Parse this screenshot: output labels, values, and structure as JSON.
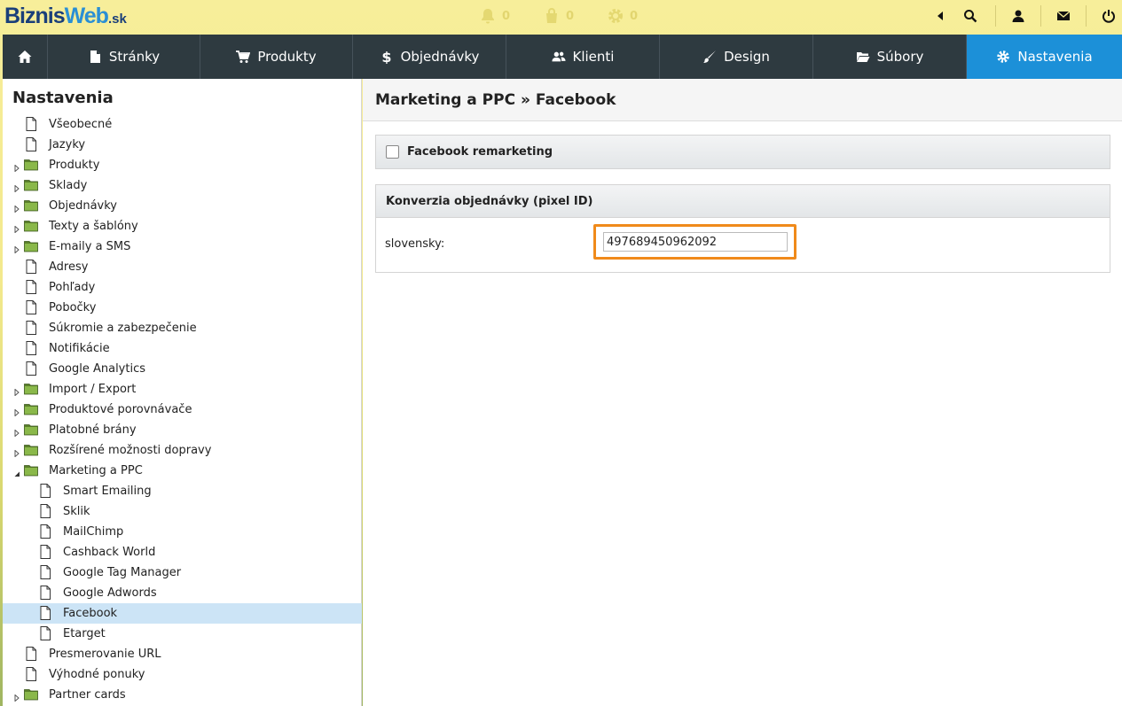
{
  "logo": {
    "part1": "Biznis",
    "part2": "Web",
    "part3": ".sk"
  },
  "counters": [
    {
      "icon": "bell-icon",
      "value": "0"
    },
    {
      "icon": "bag-icon",
      "value": "0"
    },
    {
      "icon": "gear-icon",
      "value": "0"
    }
  ],
  "top_icons": [
    "arrow-left-icon",
    "search-icon",
    "user-icon",
    "mail-icon",
    "power-icon"
  ],
  "nav": {
    "items": [
      {
        "name": "home",
        "label": ""
      },
      {
        "name": "stranky",
        "label": "Stránky"
      },
      {
        "name": "produkty",
        "label": "Produkty"
      },
      {
        "name": "objednavky",
        "label": "Objednávky"
      },
      {
        "name": "klienti",
        "label": "Klienti"
      },
      {
        "name": "design",
        "label": "Design"
      },
      {
        "name": "subory",
        "label": "Súbory"
      },
      {
        "name": "nastavenia",
        "label": "Nastavenia"
      }
    ]
  },
  "sidebar": {
    "title": "Nastavenia",
    "items": [
      {
        "label": "Všeobecné",
        "type": "page",
        "level": 0
      },
      {
        "label": "Jazyky",
        "type": "page",
        "level": 0
      },
      {
        "label": "Produkty",
        "type": "folder",
        "level": 0,
        "state": "collapsed"
      },
      {
        "label": "Sklady",
        "type": "folder",
        "level": 0,
        "state": "collapsed"
      },
      {
        "label": "Objednávky",
        "type": "folder",
        "level": 0,
        "state": "collapsed"
      },
      {
        "label": "Texty a šablóny",
        "type": "folder",
        "level": 0,
        "state": "collapsed"
      },
      {
        "label": "E-maily a SMS",
        "type": "folder",
        "level": 0,
        "state": "collapsed"
      },
      {
        "label": "Adresy",
        "type": "page",
        "level": 0
      },
      {
        "label": "Pohľady",
        "type": "page",
        "level": 0
      },
      {
        "label": "Pobočky",
        "type": "page",
        "level": 0
      },
      {
        "label": "Súkromie a zabezpečenie",
        "type": "page",
        "level": 0
      },
      {
        "label": "Notifikácie",
        "type": "page",
        "level": 0
      },
      {
        "label": "Google Analytics",
        "type": "page",
        "level": 0
      },
      {
        "label": "Import / Export",
        "type": "folder",
        "level": 0,
        "state": "collapsed"
      },
      {
        "label": "Produktové porovnávače",
        "type": "folder",
        "level": 0,
        "state": "collapsed"
      },
      {
        "label": "Platobné brány",
        "type": "folder",
        "level": 0,
        "state": "collapsed"
      },
      {
        "label": "Rozšírené možnosti dopravy",
        "type": "folder",
        "level": 0,
        "state": "collapsed"
      },
      {
        "label": "Marketing a PPC",
        "type": "folder",
        "level": 0,
        "state": "expanded"
      },
      {
        "label": "Smart Emailing",
        "type": "page",
        "level": 1
      },
      {
        "label": "Sklik",
        "type": "page",
        "level": 1
      },
      {
        "label": "MailChimp",
        "type": "page",
        "level": 1
      },
      {
        "label": "Cashback World",
        "type": "page",
        "level": 1
      },
      {
        "label": "Google Tag Manager",
        "type": "page",
        "level": 1
      },
      {
        "label": "Google Adwords",
        "type": "page",
        "level": 1
      },
      {
        "label": "Facebook",
        "type": "page",
        "level": 1,
        "selected": true
      },
      {
        "label": "Etarget",
        "type": "page",
        "level": 1
      },
      {
        "label": "Presmerovanie URL",
        "type": "page",
        "level": 0
      },
      {
        "label": "Výhodné ponuky",
        "type": "page",
        "level": 0
      },
      {
        "label": "Partner cards",
        "type": "folder",
        "level": 0,
        "state": "collapsed"
      }
    ]
  },
  "main": {
    "title": "Marketing a PPC » Facebook",
    "remarketing_label": "Facebook remarketing",
    "remarketing_checked": false,
    "conversion_title": "Konverzia objednávky (pixel ID)",
    "field_label": "slovensky:",
    "field_value": "497689450962092"
  },
  "colors": {
    "nav_bg": "#2e3a40",
    "nav_active": "#1c90d8",
    "highlight": "#f08a1a",
    "selected_row": "#cce4f6"
  }
}
